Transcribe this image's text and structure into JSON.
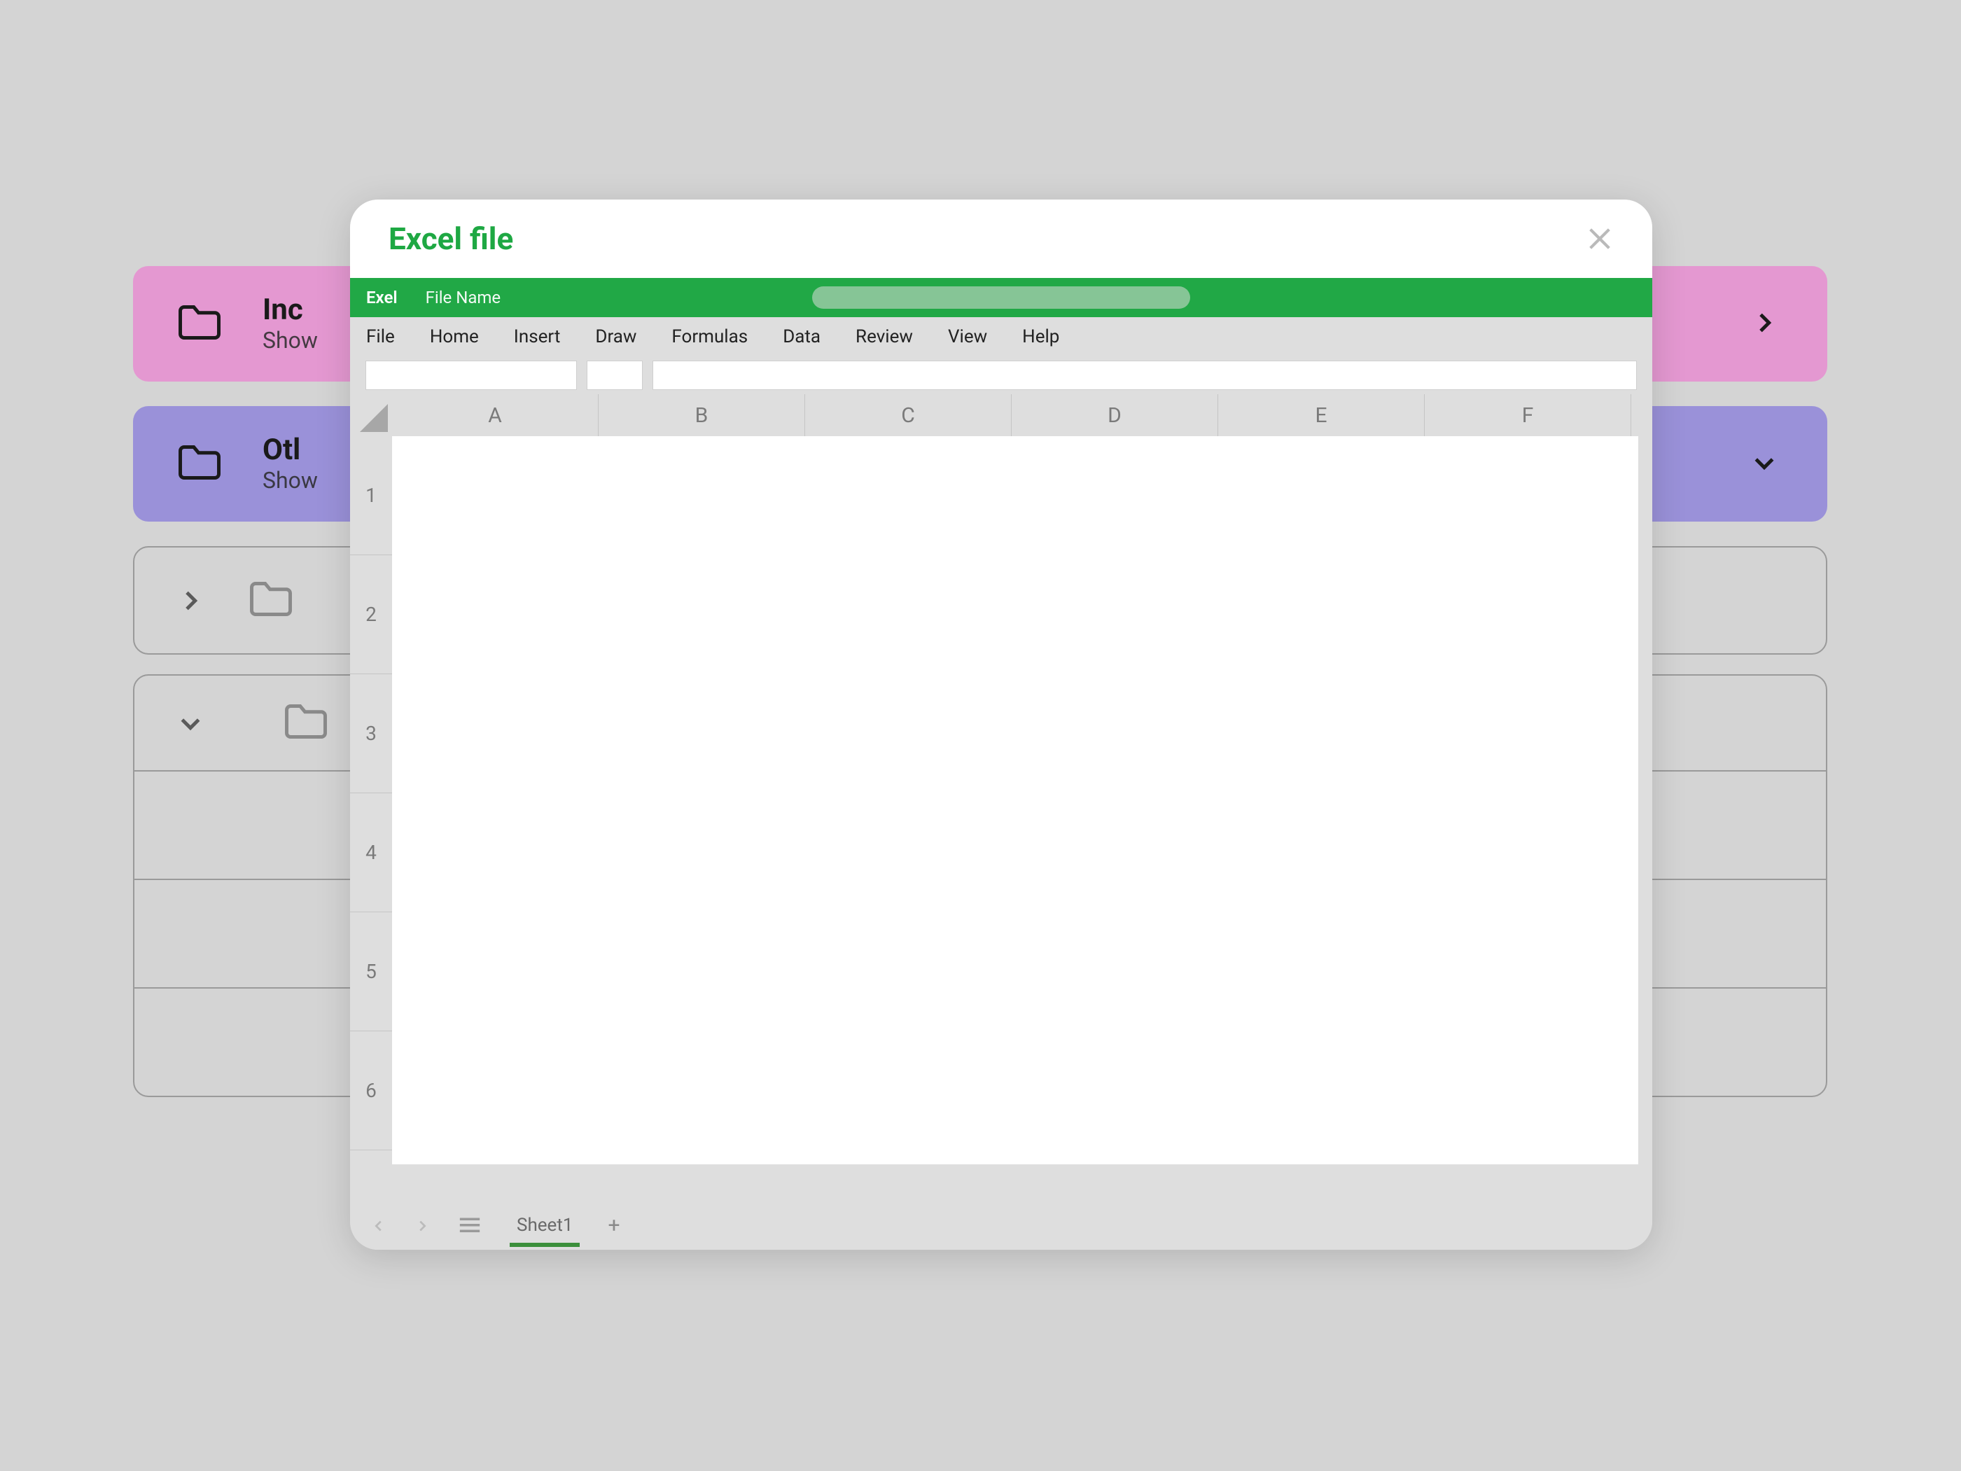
{
  "background": {
    "cards": [
      {
        "id": "inc",
        "title": "Inc",
        "subtitle": "Show"
      },
      {
        "id": "other",
        "title": "Otl",
        "subtitle": "Show"
      }
    ]
  },
  "modal": {
    "title": "Excel file",
    "topbar": {
      "app": "Exel",
      "file_label": "File Name"
    },
    "menu": [
      "File",
      "Home",
      "Insert",
      "Draw",
      "Formulas",
      "Data",
      "Review",
      "View",
      "Help"
    ],
    "columns": [
      "A",
      "B",
      "C",
      "D",
      "E",
      "F"
    ],
    "rows": [
      "1",
      "2",
      "3",
      "4",
      "5",
      "6"
    ],
    "sheet_tab": "Sheet1"
  }
}
